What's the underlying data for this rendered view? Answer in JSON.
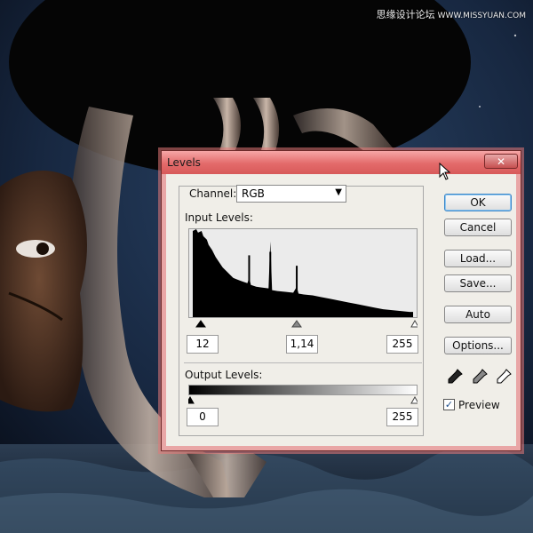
{
  "watermark": {
    "site": "思缘设计论坛",
    "url": "WWW.MISSYUAN.COM"
  },
  "dialog": {
    "title": "Levels",
    "close_glyph": "✕",
    "channel_label": "Channel:",
    "channel_value": "RGB",
    "input_levels_label": "Input Levels:",
    "input_black": "12",
    "input_gamma": "1,14",
    "input_white": "255",
    "output_levels_label": "Output Levels:",
    "output_black": "0",
    "output_white": "255",
    "buttons": {
      "ok": "OK",
      "cancel": "Cancel",
      "load": "Load...",
      "save": "Save...",
      "auto": "Auto",
      "options": "Options..."
    },
    "preview_label": "Preview",
    "preview_checked": true,
    "icons": [
      "black-eyedropper-icon",
      "gray-eyedropper-icon",
      "white-eyedropper-icon",
      "mouse-cursor-icon"
    ]
  }
}
